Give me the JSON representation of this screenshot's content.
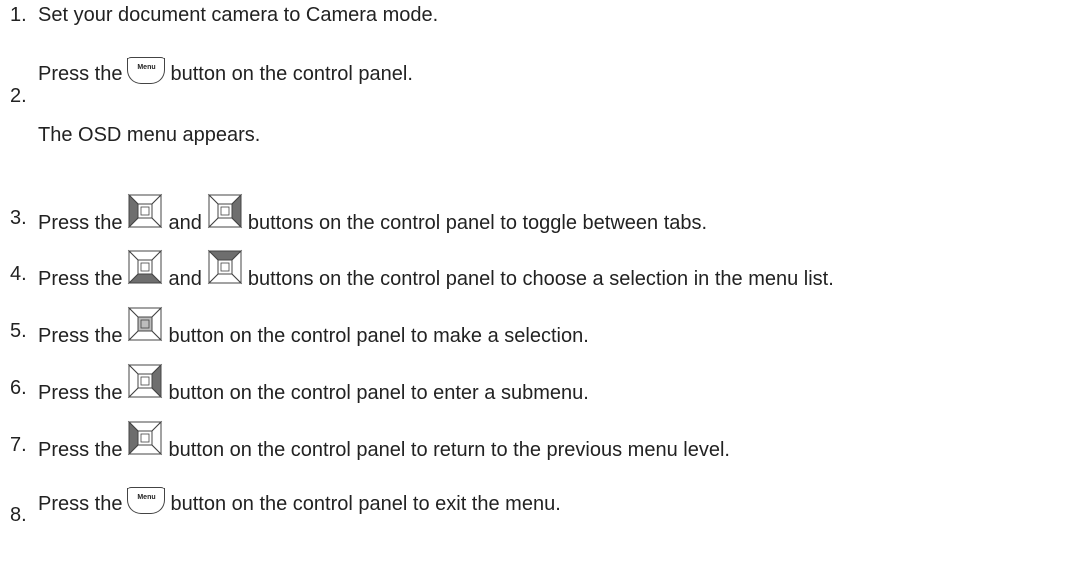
{
  "steps": [
    {
      "number": "1.",
      "parts": [
        "Set your document camera to Camera mode."
      ]
    },
    {
      "number": "2.",
      "before": "Press the",
      "icon": "menu-button-icon",
      "icon_label": "Menu",
      "after": "button on the control panel.",
      "note": "The OSD menu appears."
    },
    {
      "number": "3.",
      "before": "Press the",
      "icon": "dpad-left-icon",
      "mid": "and",
      "icon2": "dpad-right-icon",
      "after": "buttons on the control panel to toggle between tabs."
    },
    {
      "number": "4.",
      "before": "Press the",
      "icon": "dpad-down-icon",
      "mid": "and",
      "icon2": "dpad-up-icon",
      "after": "buttons on the control panel to choose a selection in the menu list."
    },
    {
      "number": "5.",
      "before": "Press the",
      "icon": "dpad-center-icon",
      "after": "button on the control panel to make a selection."
    },
    {
      "number": "6.",
      "before": "Press the",
      "icon": "dpad-right-icon",
      "after": "button on the control panel to enter a submenu."
    },
    {
      "number": "7.",
      "before": "Press the",
      "icon": "dpad-left-icon",
      "after": "button on the control panel to return to the previous menu level."
    },
    {
      "number": "8.",
      "before": "Press the",
      "icon": "menu-button-icon",
      "icon_label": "Menu",
      "after": "button on the control panel to exit the menu."
    }
  ],
  "colors": {
    "highlight": "#6e6e6e",
    "center_highlight": "#bdbdbd",
    "stroke": "#444444"
  }
}
